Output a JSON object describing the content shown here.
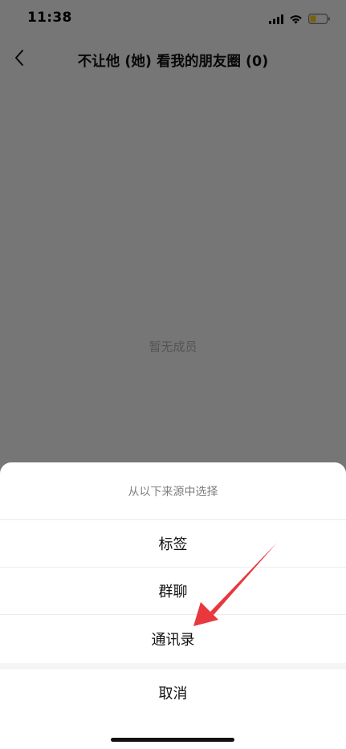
{
  "status_bar": {
    "time": "11:38",
    "icons": [
      "signal-icon",
      "wifi-icon",
      "battery-icon"
    ],
    "battery_color": "#f2c31b"
  },
  "nav": {
    "title": "不让他 (她) 看我的朋友圈 (0)",
    "back_icon": "chevron-left-icon"
  },
  "content": {
    "empty_text": "暂无成员"
  },
  "action_sheet": {
    "header": "从以下来源中选择",
    "options": [
      {
        "label": "标签"
      },
      {
        "label": "群聊"
      },
      {
        "label": "通讯录"
      }
    ],
    "cancel_label": "取消"
  },
  "annotation": {
    "type": "arrow",
    "color": "#e8383d",
    "points_to": "通讯录"
  }
}
